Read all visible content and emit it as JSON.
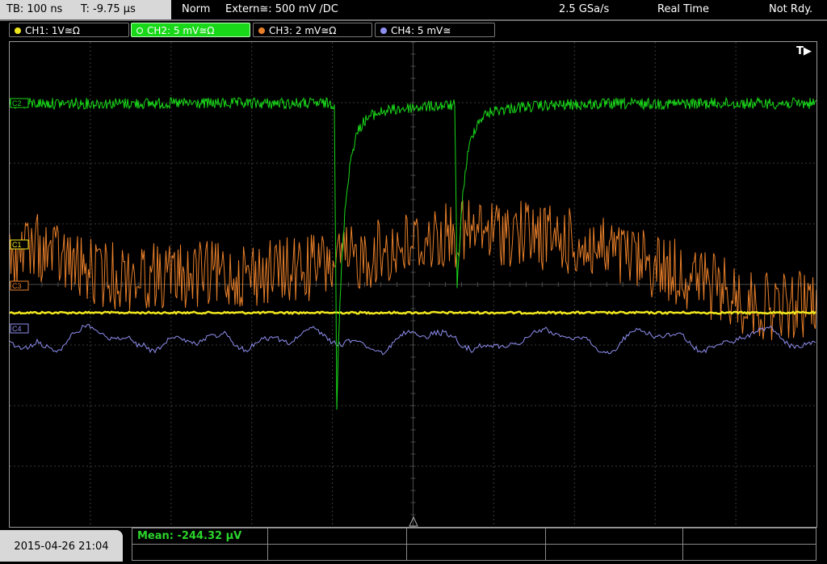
{
  "status_bar": {
    "timebase": "TB: 100 ns",
    "trigger_time": "T: -9.75 µs",
    "mode": "Norm",
    "trigger": "Extern≅: 500 mV ∕DC",
    "sample_rate": "2.5 GSa/s",
    "acquisition": "Real Time",
    "state": "Not Rdy."
  },
  "channels": [
    {
      "id": "ch1",
      "label": "CH1: 1V≅Ω",
      "color": "#f0e61e"
    },
    {
      "id": "ch2",
      "label": "CH2: 5 mV≅Ω",
      "color": "#19d819"
    },
    {
      "id": "ch3",
      "label": "CH3: 2 mV≅Ω",
      "color": "#e87f2a"
    },
    {
      "id": "ch4",
      "label": "CH4: 5 mV≅",
      "color": "#8f8ff2"
    }
  ],
  "plot": {
    "trigger_marker": "T▶",
    "markers": {
      "c1": "C1",
      "c2": "C2",
      "c3": "C3",
      "c4": "C4"
    },
    "colors": {
      "grid": "#3a3a3a",
      "ch1": "#f0e61e",
      "ch2": "#19d819",
      "ch3": "#e87f2a",
      "ch4": "#8f8ff2"
    }
  },
  "footer": {
    "datetime": "2015-04-26 21:04",
    "measurement": "Mean: -244.32 µV"
  }
}
